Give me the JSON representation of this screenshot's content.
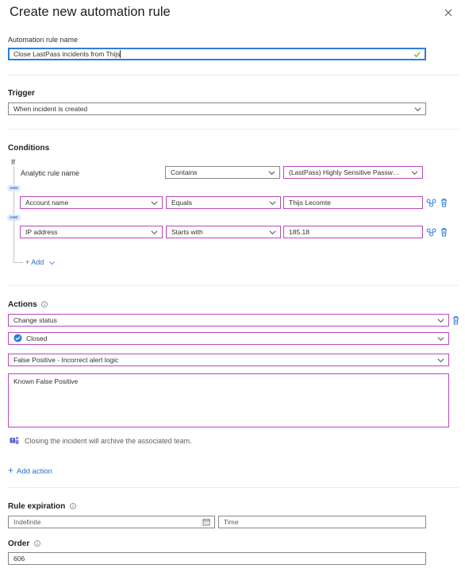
{
  "header": {
    "title": "Create new automation rule"
  },
  "rule_name": {
    "label": "Automation rule name",
    "value": "Close LastPass incidents from Thijs"
  },
  "trigger": {
    "label": "Trigger",
    "value": "When incident is created"
  },
  "conditions": {
    "label": "Conditions",
    "if_label": "If",
    "and_label": "AND",
    "analytic_rule": {
      "label": "Analytic rule name",
      "operator": "Contains",
      "value": "(LastPass) Highly Sensitive Passwor..."
    },
    "rows": [
      {
        "property": "Account name",
        "operator": "Equals",
        "value": "Thijs Lecomte"
      },
      {
        "property": "IP address",
        "operator": "Starts with",
        "value": "185.18"
      }
    ],
    "add_label": "+ Add"
  },
  "actions": {
    "label": "Actions",
    "action_type": "Change status",
    "status": "Closed",
    "classification": "False Positive - Incorrect alert logic",
    "comment": "Known False Positive",
    "teams_note": "Closing the incident will archive the associated team.",
    "add_action_label": "Add action"
  },
  "expiration": {
    "label": "Rule expiration",
    "date_placeholder": "Indefinite",
    "time_placeholder": "Time"
  },
  "order": {
    "label": "Order",
    "value": "606"
  },
  "colors": {
    "accent": "#2f7ddc",
    "condition_border": "#b84ab7",
    "link": "#2b6fc8",
    "valid_check": "#57a300"
  }
}
